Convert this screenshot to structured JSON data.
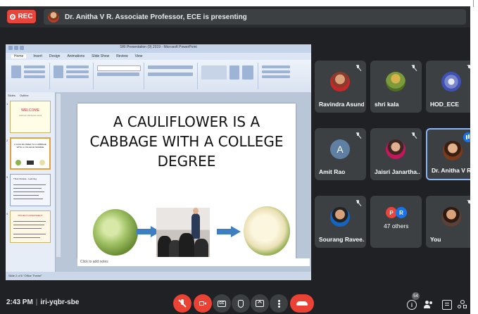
{
  "topbar": {
    "rec_label": "REC",
    "presenting_text": "Dr. Anitha V R. Associate Professor, ECE is presenting"
  },
  "powerpoint": {
    "window_title": "SRI Presentation (9) 2019 - Microsoft PowerPoint",
    "tabs": [
      "Home",
      "Insert",
      "Design",
      "Animations",
      "Slide Show",
      "Review",
      "View"
    ],
    "panel_tabs": [
      "Slides",
      "Outline"
    ],
    "slide_title": "A CAULIFLOWER IS A CABBAGE WITH A COLLEGE DEGREE",
    "thumbnails": [
      {
        "number": "1",
        "title": "WELCOME",
        "subtitle": "ANITHA VENKATA RAJI"
      },
      {
        "number": "2",
        "title": "A CAULIFLOWER IS A CABBAGE WITH A COLLEGE DEGREE",
        "subtitle": ""
      },
      {
        "number": "3",
        "title": "Think Outside - Learning",
        "subtitle": ""
      },
      {
        "number": "4",
        "title": "PROJECT ASSESSMENT",
        "subtitle": ""
      }
    ],
    "notes_placeholder": "Click to add notes",
    "status_text": "Slide 2 of 6    \"Office Theme\""
  },
  "participants": [
    {
      "name": "Ravindra Asundi",
      "muted": true,
      "avatar_color": "#8b3a2b"
    },
    {
      "name": "shri kala",
      "muted": true,
      "avatar_color": "#6b8f35"
    },
    {
      "name": "HOD_ECE",
      "muted": true,
      "avatar_color": "#3f51b5"
    },
    {
      "name": "Amit Rao",
      "muted": true,
      "avatar_letter": "A",
      "avatar_color": "#5f7fa3"
    },
    {
      "name": "Jaisri Janartha...",
      "muted": true,
      "avatar_color": "#c2185b"
    },
    {
      "name": "Dr. Anitha V R. ...",
      "speaking": true,
      "avatar_color": "#7a3b1c"
    },
    {
      "name": "Sourang Ravee...",
      "muted": true,
      "avatar_color": "#1565c0"
    },
    {
      "name": "47 others",
      "others": [
        "P",
        "R"
      ],
      "other_colors": [
        "#e8453c",
        "#1a73e8"
      ]
    },
    {
      "name": "You",
      "muted": true,
      "avatar_color": "#5d4037"
    }
  ],
  "bottombar": {
    "time": "2:43 PM",
    "meeting_code": "iri-yqbr-sbe",
    "cc_label": "CC",
    "people_count": "54",
    "info_label": "i"
  },
  "colors": {
    "meet_bg": "#202124",
    "tile_bg": "#3c4043",
    "danger": "#ea4335",
    "accent": "#1a73e8"
  }
}
